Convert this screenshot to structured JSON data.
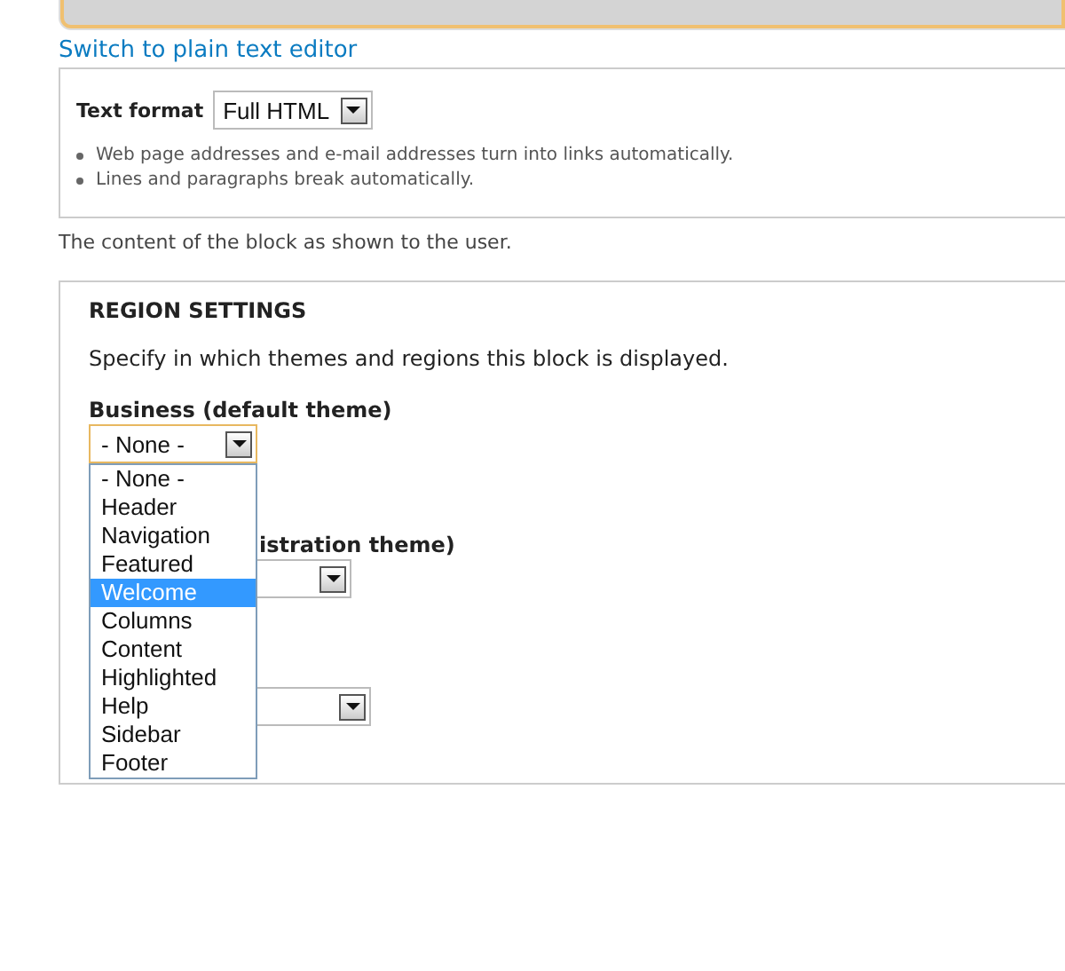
{
  "editor_link": "Switch to plain text editor",
  "text_format": {
    "label": "Text format",
    "value": "Full HTML",
    "tips": [
      "Web page addresses and e-mail addresses turn into links automatically.",
      "Lines and paragraphs break automatically."
    ]
  },
  "body_description": "The content of the block as shown to the user.",
  "region_settings": {
    "title": "REGION SETTINGS",
    "description": "Specify in which themes and regions this block is displayed.",
    "themes": [
      {
        "label": "Business (default theme)",
        "value": "- None -",
        "focused": true
      },
      {
        "label": "istration theme)",
        "focused": false
      },
      {
        "focused": false
      }
    ],
    "dropdown": [
      {
        "label": "- None -",
        "selected": false
      },
      {
        "label": "Header",
        "selected": false
      },
      {
        "label": "Navigation",
        "selected": false
      },
      {
        "label": "Featured",
        "selected": false
      },
      {
        "label": "Welcome",
        "selected": true
      },
      {
        "label": "Columns",
        "selected": false
      },
      {
        "label": "Content",
        "selected": false
      },
      {
        "label": "Highlighted",
        "selected": false
      },
      {
        "label": "Help",
        "selected": false
      },
      {
        "label": "Sidebar",
        "selected": false
      },
      {
        "label": "Footer",
        "selected": false
      }
    ]
  }
}
